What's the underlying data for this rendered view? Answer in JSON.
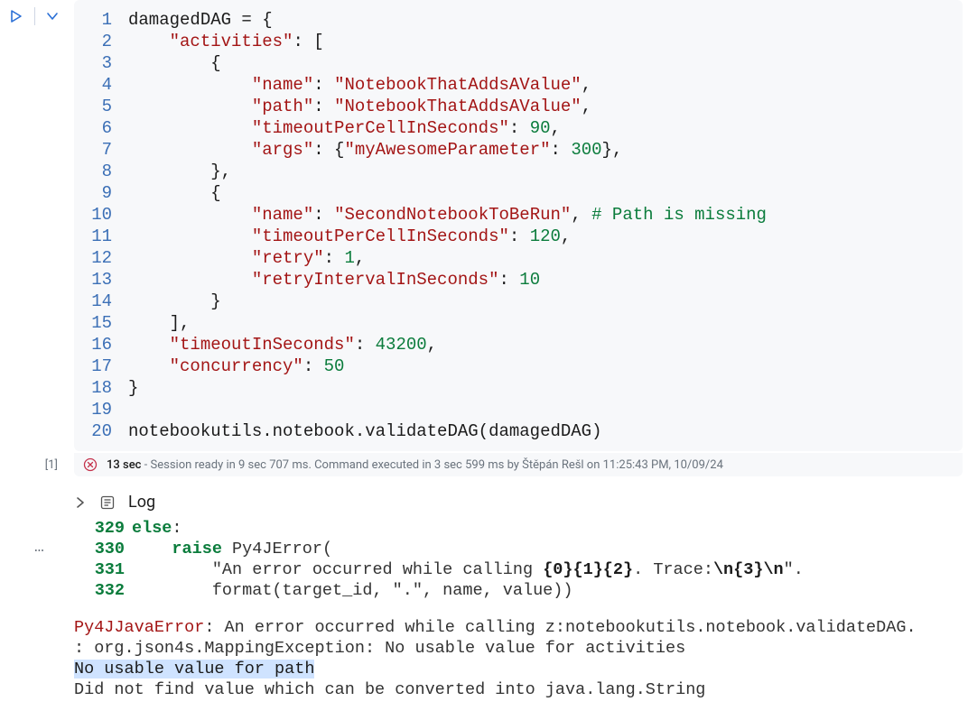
{
  "cell": {
    "exec_count": "[1]",
    "lines": [
      {
        "n": "1",
        "seg": [
          {
            "c": "tok-var",
            "t": "damagedDAG "
          },
          {
            "c": "tok-punct",
            "t": "= {"
          }
        ]
      },
      {
        "n": "2",
        "seg": [
          {
            "c": "tok-punct",
            "t": "    "
          },
          {
            "c": "tok-str",
            "t": "\"activities\""
          },
          {
            "c": "tok-punct",
            "t": ": ["
          }
        ]
      },
      {
        "n": "3",
        "seg": [
          {
            "c": "tok-punct",
            "t": "        {"
          }
        ]
      },
      {
        "n": "4",
        "seg": [
          {
            "c": "tok-punct",
            "t": "            "
          },
          {
            "c": "tok-str",
            "t": "\"name\""
          },
          {
            "c": "tok-punct",
            "t": ": "
          },
          {
            "c": "tok-str",
            "t": "\"NotebookThatAddsAValue\""
          },
          {
            "c": "tok-punct",
            "t": ","
          }
        ]
      },
      {
        "n": "5",
        "seg": [
          {
            "c": "tok-punct",
            "t": "            "
          },
          {
            "c": "tok-str",
            "t": "\"path\""
          },
          {
            "c": "tok-punct",
            "t": ": "
          },
          {
            "c": "tok-str",
            "t": "\"NotebookThatAddsAValue\""
          },
          {
            "c": "tok-punct",
            "t": ","
          }
        ]
      },
      {
        "n": "6",
        "seg": [
          {
            "c": "tok-punct",
            "t": "            "
          },
          {
            "c": "tok-str",
            "t": "\"timeoutPerCellInSeconds\""
          },
          {
            "c": "tok-punct",
            "t": ": "
          },
          {
            "c": "tok-num",
            "t": "90"
          },
          {
            "c": "tok-punct",
            "t": ","
          }
        ]
      },
      {
        "n": "7",
        "seg": [
          {
            "c": "tok-punct",
            "t": "            "
          },
          {
            "c": "tok-str",
            "t": "\"args\""
          },
          {
            "c": "tok-punct",
            "t": ": {"
          },
          {
            "c": "tok-str",
            "t": "\"myAwesomeParameter\""
          },
          {
            "c": "tok-punct",
            "t": ": "
          },
          {
            "c": "tok-num",
            "t": "300"
          },
          {
            "c": "tok-punct",
            "t": "},"
          }
        ]
      },
      {
        "n": "8",
        "seg": [
          {
            "c": "tok-punct",
            "t": "        },"
          }
        ]
      },
      {
        "n": "9",
        "seg": [
          {
            "c": "tok-punct",
            "t": "        {"
          }
        ]
      },
      {
        "n": "10",
        "seg": [
          {
            "c": "tok-punct",
            "t": "            "
          },
          {
            "c": "tok-str",
            "t": "\"name\""
          },
          {
            "c": "tok-punct",
            "t": ": "
          },
          {
            "c": "tok-str",
            "t": "\"SecondNotebookToBeRun\""
          },
          {
            "c": "tok-punct",
            "t": ", "
          },
          {
            "c": "tok-comment",
            "t": "# Path is missing"
          }
        ]
      },
      {
        "n": "11",
        "seg": [
          {
            "c": "tok-punct",
            "t": "            "
          },
          {
            "c": "tok-str",
            "t": "\"timeoutPerCellInSeconds\""
          },
          {
            "c": "tok-punct",
            "t": ": "
          },
          {
            "c": "tok-num",
            "t": "120"
          },
          {
            "c": "tok-punct",
            "t": ","
          }
        ]
      },
      {
        "n": "12",
        "seg": [
          {
            "c": "tok-punct",
            "t": "            "
          },
          {
            "c": "tok-str",
            "t": "\"retry\""
          },
          {
            "c": "tok-punct",
            "t": ": "
          },
          {
            "c": "tok-num",
            "t": "1"
          },
          {
            "c": "tok-punct",
            "t": ","
          }
        ]
      },
      {
        "n": "13",
        "seg": [
          {
            "c": "tok-punct",
            "t": "            "
          },
          {
            "c": "tok-str",
            "t": "\"retryIntervalInSeconds\""
          },
          {
            "c": "tok-punct",
            "t": ": "
          },
          {
            "c": "tok-num",
            "t": "10"
          }
        ]
      },
      {
        "n": "14",
        "seg": [
          {
            "c": "tok-punct",
            "t": "        }"
          }
        ]
      },
      {
        "n": "15",
        "seg": [
          {
            "c": "tok-punct",
            "t": "    ],"
          }
        ]
      },
      {
        "n": "16",
        "seg": [
          {
            "c": "tok-punct",
            "t": "    "
          },
          {
            "c": "tok-str",
            "t": "\"timeoutInSeconds\""
          },
          {
            "c": "tok-punct",
            "t": ": "
          },
          {
            "c": "tok-num",
            "t": "43200"
          },
          {
            "c": "tok-punct",
            "t": ","
          }
        ]
      },
      {
        "n": "17",
        "seg": [
          {
            "c": "tok-punct",
            "t": "    "
          },
          {
            "c": "tok-str",
            "t": "\"concurrency\""
          },
          {
            "c": "tok-punct",
            "t": ": "
          },
          {
            "c": "tok-num",
            "t": "50"
          }
        ]
      },
      {
        "n": "18",
        "seg": [
          {
            "c": "tok-punct",
            "t": "}"
          }
        ]
      },
      {
        "n": "19",
        "seg": [
          {
            "c": "tok-punct",
            "t": ""
          }
        ]
      },
      {
        "n": "20",
        "seg": [
          {
            "c": "tok-call",
            "t": "notebookutils.notebook.validateDAG(damagedDAG)"
          }
        ]
      }
    ],
    "status": {
      "duration": "13 sec",
      "text": " - Session ready in 9 sec 707 ms. Command executed in 3 sec 599 ms by Štěpán Rešl on 11:25:43 PM, 10/09/24"
    }
  },
  "log": {
    "label": "Log"
  },
  "output": {
    "lines": [
      {
        "n": "329",
        "seg": [
          {
            "c": "out-kw",
            "t": "else"
          },
          {
            "c": "out-plain",
            "t": ":"
          }
        ]
      },
      {
        "n": "330",
        "seg": [
          {
            "c": "out-plain",
            "t": "    "
          },
          {
            "c": "out-kw",
            "t": "raise"
          },
          {
            "c": "out-plain",
            "t": " Py4JError("
          }
        ]
      },
      {
        "n": "331",
        "seg": [
          {
            "c": "out-plain",
            "t": "        \"An error occurred while calling "
          },
          {
            "c": "out-bold",
            "t": "{0}{1}{2}"
          },
          {
            "c": "out-plain",
            "t": ". Trace:"
          },
          {
            "c": "out-bold",
            "t": "\\n{3}\\n"
          },
          {
            "c": "out-plain",
            "t": "\"."
          }
        ]
      },
      {
        "n": "332",
        "seg": [
          {
            "c": "out-plain",
            "t": "        format(target_id, \".\", name, value))"
          }
        ]
      }
    ],
    "error": [
      {
        "seg": [
          {
            "c": "out-err",
            "t": "Py4JJavaError"
          },
          {
            "c": "out-plain",
            "t": ": An error occurred while calling z:notebookutils.notebook.validateDAG."
          }
        ]
      },
      {
        "seg": [
          {
            "c": "out-plain",
            "t": ": org.json4s.MappingException: No usable value for activities"
          }
        ]
      },
      {
        "seg": [
          {
            "c": "out-hl",
            "t": "No usable value for path"
          }
        ]
      },
      {
        "seg": [
          {
            "c": "out-plain",
            "t": "Did not find value which can be converted into java.lang.String"
          }
        ]
      }
    ]
  },
  "more_menu": "…"
}
